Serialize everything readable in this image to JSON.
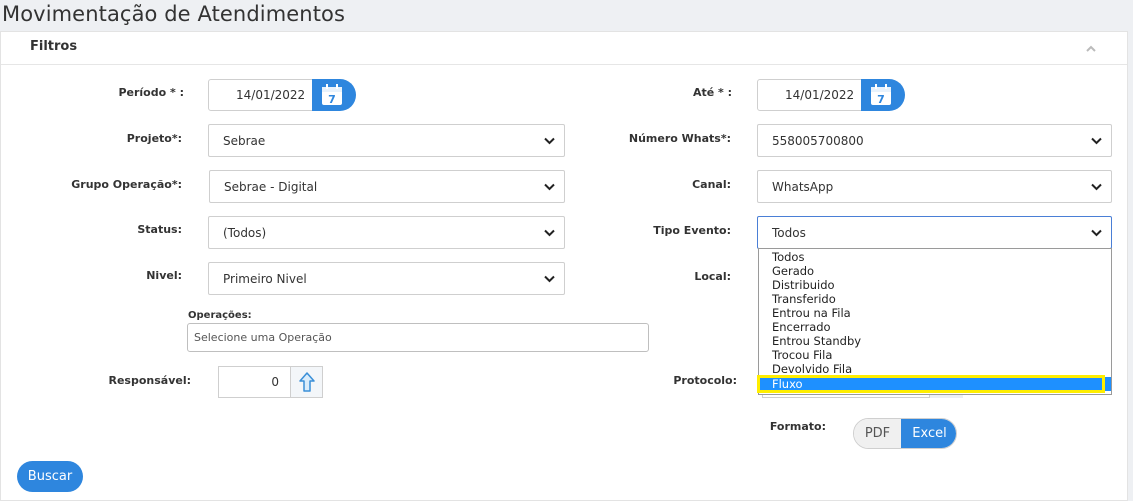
{
  "page": {
    "title": "Movimentação de Atendimentos"
  },
  "panel": {
    "title": "Filtros"
  },
  "fields": {
    "periodo": {
      "label": "Período * :",
      "value": "14/01/2022"
    },
    "ate": {
      "label": "Até * :",
      "value": "14/01/2022"
    },
    "projeto": {
      "label": "Projeto*:",
      "value": "Sebrae"
    },
    "numero_whats": {
      "label": "Número Whats*:",
      "value": "558005700800"
    },
    "grupo_operacao": {
      "label": "Grupo Operação*:",
      "value": "Sebrae - Digital"
    },
    "canal": {
      "label": "Canal:",
      "value": "WhatsApp"
    },
    "status": {
      "label": "Status:",
      "value": "(Todos)"
    },
    "tipo_evento": {
      "label": "Tipo Evento:",
      "value": "Todos"
    },
    "nivel": {
      "label": "Nivel:",
      "value": "Primeiro Nivel"
    },
    "local": {
      "label": "Local:"
    },
    "operacoes": {
      "label": "Operações:",
      "placeholder": "Selecione uma Operação"
    },
    "responsavel": {
      "label": "Responsável:",
      "value": "0"
    },
    "protocolo": {
      "label": "Protocolo:"
    },
    "formato": {
      "label": "Formato:",
      "options": [
        "PDF",
        "Excel"
      ],
      "selected": "Excel"
    }
  },
  "dropdown": {
    "options": [
      "Todos",
      "Gerado",
      "Distribuido",
      "Transferido",
      "Entrou na Fila",
      "Encerrado",
      "Entrou Standby",
      "Trocou Fila",
      "Devolvido Fila",
      "Fluxo"
    ],
    "highlighted": "Fluxo"
  },
  "buttons": {
    "buscar": "Buscar"
  },
  "colors": {
    "primary": "#2e86de",
    "highlight_border": "#ffee00",
    "selected_option": "#1e90ff"
  }
}
